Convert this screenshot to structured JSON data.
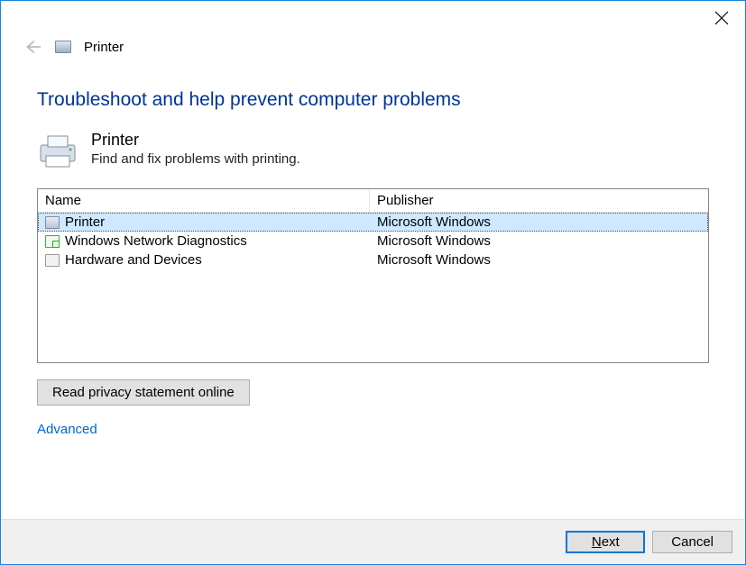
{
  "header": {
    "title": "Printer"
  },
  "main": {
    "heading": "Troubleshoot and help prevent computer problems",
    "section_title": "Printer",
    "section_sub": "Find and fix problems with printing."
  },
  "list": {
    "columns": {
      "name": "Name",
      "publisher": "Publisher"
    },
    "rows": [
      {
        "name": "Printer",
        "publisher": "Microsoft Windows",
        "icon": "printer",
        "selected": true
      },
      {
        "name": "Windows Network Diagnostics",
        "publisher": "Microsoft Windows",
        "icon": "net",
        "selected": false
      },
      {
        "name": "Hardware and Devices",
        "publisher": "Microsoft Windows",
        "icon": "hw",
        "selected": false
      }
    ]
  },
  "buttons": {
    "privacy": "Read privacy statement online",
    "advanced": "Advanced",
    "next": "Next",
    "cancel": "Cancel"
  }
}
